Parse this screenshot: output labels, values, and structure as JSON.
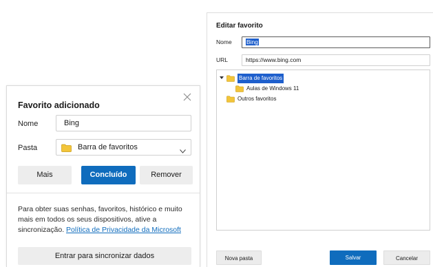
{
  "added_dialog": {
    "title": "Favorito adicionado",
    "close_icon": "close-icon",
    "name_label": "Nome",
    "name_value": "Bing",
    "folder_label": "Pasta",
    "folder_value": "Barra de favoritos",
    "more_button": "Mais",
    "done_button": "Concluído",
    "remove_button": "Remover",
    "sync_text": "Para obter suas senhas, favoritos, histórico e muito mais em todos os seus dispositivos, ative a sincronização.",
    "privacy_link": "Política de Privacidade da Microsoft",
    "sync_button": "Entrar para sincronizar dados"
  },
  "edit_dialog": {
    "title": "Editar favorito",
    "name_label": "Nome",
    "name_value": "Bing",
    "url_label": "URL",
    "url_value": "https://www.bing.com",
    "tree": [
      {
        "label": "Barra de favoritos",
        "expanded": true,
        "selected": true
      },
      {
        "label": "Aulas de Windows 11",
        "selected": false
      },
      {
        "label": "Outros favoritos",
        "selected": false
      }
    ],
    "new_folder_button": "Nova pasta",
    "save_button": "Salvar",
    "cancel_button": "Cancelar"
  },
  "colors": {
    "accent": "#0f6cbd",
    "selection": "#1e5fcc",
    "folder": "#f3c53a"
  }
}
